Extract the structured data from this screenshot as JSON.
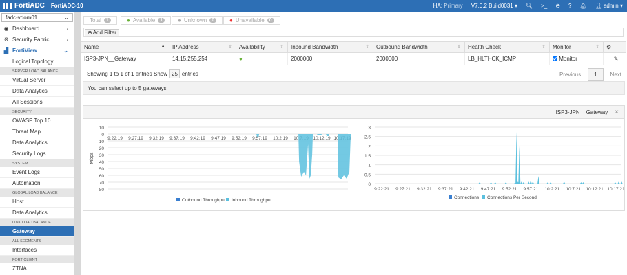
{
  "header": {
    "brand": "FortiADC",
    "hostname": "FortiADC-10",
    "ha_label": "HA:",
    "ha_value": "Primary",
    "version": "V7.0.2 Build0031",
    "user": "admin"
  },
  "sidebar": {
    "vdom": "fadc-vdom01",
    "items": [
      {
        "type": "item",
        "label": "Dashboard",
        "icon": "dashboard-icon",
        "chevron": "›"
      },
      {
        "type": "item",
        "label": "Security Fabric",
        "icon": "fabric-icon",
        "chevron": "›"
      },
      {
        "type": "item",
        "label": "FortiView",
        "icon": "chart-icon",
        "chevron": "⌄",
        "expanded": true
      },
      {
        "type": "sub",
        "label": "Logical Topology"
      },
      {
        "type": "section",
        "label": "SERVER LOAD BALANCE"
      },
      {
        "type": "sub",
        "label": "Virtual Server"
      },
      {
        "type": "sub",
        "label": "Data Analytics"
      },
      {
        "type": "sub",
        "label": "All Sessions"
      },
      {
        "type": "section",
        "label": "SECURITY"
      },
      {
        "type": "sub",
        "label": "OWASP Top 10"
      },
      {
        "type": "sub",
        "label": "Threat Map"
      },
      {
        "type": "sub",
        "label": "Data Analytics"
      },
      {
        "type": "sub",
        "label": "Security Logs"
      },
      {
        "type": "section",
        "label": "SYSTEM"
      },
      {
        "type": "sub",
        "label": "Event Logs"
      },
      {
        "type": "sub",
        "label": "Automation"
      },
      {
        "type": "section",
        "label": "GLOBAL LOAD BALANCE"
      },
      {
        "type": "sub",
        "label": "Host"
      },
      {
        "type": "sub",
        "label": "Data Analytics"
      },
      {
        "type": "section",
        "label": "LINK LOAD BALANCE"
      },
      {
        "type": "sub",
        "label": "Gateway",
        "active": true
      },
      {
        "type": "section",
        "label": "ALL SEGMENTS"
      },
      {
        "type": "sub",
        "label": "Interfaces"
      },
      {
        "type": "section",
        "label": "FORTICLIENT"
      },
      {
        "type": "sub",
        "label": "ZTNA"
      }
    ]
  },
  "status": {
    "total": {
      "label": "Total",
      "count": "1"
    },
    "available": {
      "label": "Available",
      "count": "1"
    },
    "unknown": {
      "label": "Unknown",
      "count": "0"
    },
    "unavailable": {
      "label": "Unavailable",
      "count": "0"
    }
  },
  "filter": {
    "add_label": "Add Filter"
  },
  "table": {
    "columns": [
      "Name",
      "IP Address",
      "Availability",
      "Inbound Bandwidth",
      "Outbound Bandwidth",
      "Health Check",
      "Monitor"
    ],
    "rows": [
      {
        "name": "ISP3-JPN__Gateway",
        "ip": "14.15.255.254",
        "availability": "available",
        "inbound": "2000000",
        "outbound": "2000000",
        "health": "LB_HLTHCK_ICMP",
        "monitor": "Monitor",
        "monitor_checked": true
      }
    ]
  },
  "pagination": {
    "info": "Showing 1 to 1 of 1 entries",
    "show": "Show",
    "page_size": "25",
    "entries": "entries",
    "previous": "Previous",
    "page": "1",
    "next": "Next"
  },
  "note": "You can select up to 5 gateways.",
  "panel": {
    "title": "ISP3-JPN__Gateway",
    "close": "×"
  },
  "colors": {
    "brand": "#2d6fb5",
    "series_dark": "#3a7fd0",
    "series_light": "#5bc0de",
    "ok": "#6ab23a",
    "error": "#e33"
  },
  "chart_data": [
    {
      "type": "area",
      "ylabel": "Mbps",
      "yticks": [
        "10",
        "0",
        "10",
        "20",
        "30",
        "40",
        "50",
        "60",
        "70",
        "80"
      ],
      "ylim": [
        -10,
        80
      ],
      "xticks": [
        "9:22:19",
        "9:27:19",
        "9:32:19",
        "9:37:19",
        "9:42:19",
        "9:47:19",
        "9:52:19",
        "9:57:19",
        "10:2:19",
        "10:7:19",
        "10:12:19",
        "10:17:19"
      ],
      "series": [
        {
          "name": "Outbound Throughput",
          "values": []
        },
        {
          "name": "Inbound Throughput",
          "points": [
            [
              "9:56:30",
              0
            ],
            [
              "9:56:40",
              5
            ],
            [
              "9:57:00",
              5
            ],
            [
              "9:57:10",
              0
            ],
            [
              "10:6:40",
              0
            ],
            [
              "10:6:50",
              40
            ],
            [
              "10:7:20",
              62
            ],
            [
              "10:8:00",
              55
            ],
            [
              "10:8:30",
              60
            ],
            [
              "10:9:00",
              15
            ],
            [
              "10:9:20",
              65
            ],
            [
              "10:9:40",
              60
            ],
            [
              "10:10:00",
              30
            ],
            [
              "10:10:10",
              0
            ],
            [
              "10:11:10",
              0
            ],
            [
              "10:11:20",
              2
            ],
            [
              "10:12:10",
              2
            ],
            [
              "10:12:20",
              0
            ],
            [
              "10:13:20",
              0
            ],
            [
              "10:13:30",
              3
            ],
            [
              "10:14:00",
              3
            ],
            [
              "10:14:10",
              0
            ],
            [
              "10:16:10",
              0
            ],
            [
              "10:16:20",
              63
            ],
            [
              "10:17:00",
              66
            ],
            [
              "10:17:40",
              60
            ],
            [
              "10:18:20",
              65
            ],
            [
              "10:19:00",
              55
            ],
            [
              "10:19:20",
              0
            ]
          ]
        }
      ]
    },
    {
      "type": "area",
      "yticks": [
        "3",
        "2.5",
        "2",
        "1.5",
        "1",
        "0.5",
        "0"
      ],
      "ylim": [
        0,
        3
      ],
      "xticks": [
        "9:22:21",
        "9:27:21",
        "9:32:21",
        "9:37:21",
        "9:42:21",
        "9:47:21",
        "9:52:21",
        "9:57:21",
        "10:2:21",
        "10:7:21",
        "10:12:21",
        "10:17:21"
      ],
      "series": [
        {
          "name": "Connections",
          "values": []
        },
        {
          "name": "Connections Per Second",
          "points": [
            [
              "9:45:20",
              0.07
            ],
            [
              "9:48:00",
              0.07
            ],
            [
              "9:49:00",
              0.07
            ],
            [
              "9:51:30",
              0.07
            ],
            [
              "9:53:40",
              0.05
            ],
            [
              "9:54:00",
              2.75
            ],
            [
              "9:54:20",
              0.1
            ],
            [
              "9:54:40",
              2.0
            ],
            [
              "9:55:10",
              0.1
            ],
            [
              "9:55:40",
              0.08
            ],
            [
              "9:56:50",
              0.1
            ],
            [
              "9:57:20",
              0.15
            ],
            [
              "9:57:50",
              0.1
            ],
            [
              "9:59:10",
              0.4
            ],
            [
              "10:1:20",
              0.07
            ],
            [
              "10:2:00",
              0.07
            ],
            [
              "10:5:10",
              0.1
            ],
            [
              "10:9:10",
              0.07
            ],
            [
              "10:9:40",
              0.07
            ],
            [
              "10:17:10",
              0.07
            ],
            [
              "10:18:00",
              0.1
            ],
            [
              "10:18:40",
              0.1
            ],
            [
              "10:19:30",
              0.1
            ],
            [
              "10:20:10",
              0.1
            ],
            [
              "10:20:50",
              0.1
            ],
            [
              "10:21:30",
              0.1
            ],
            [
              "10:22:00",
              0.1
            ]
          ]
        }
      ]
    }
  ]
}
